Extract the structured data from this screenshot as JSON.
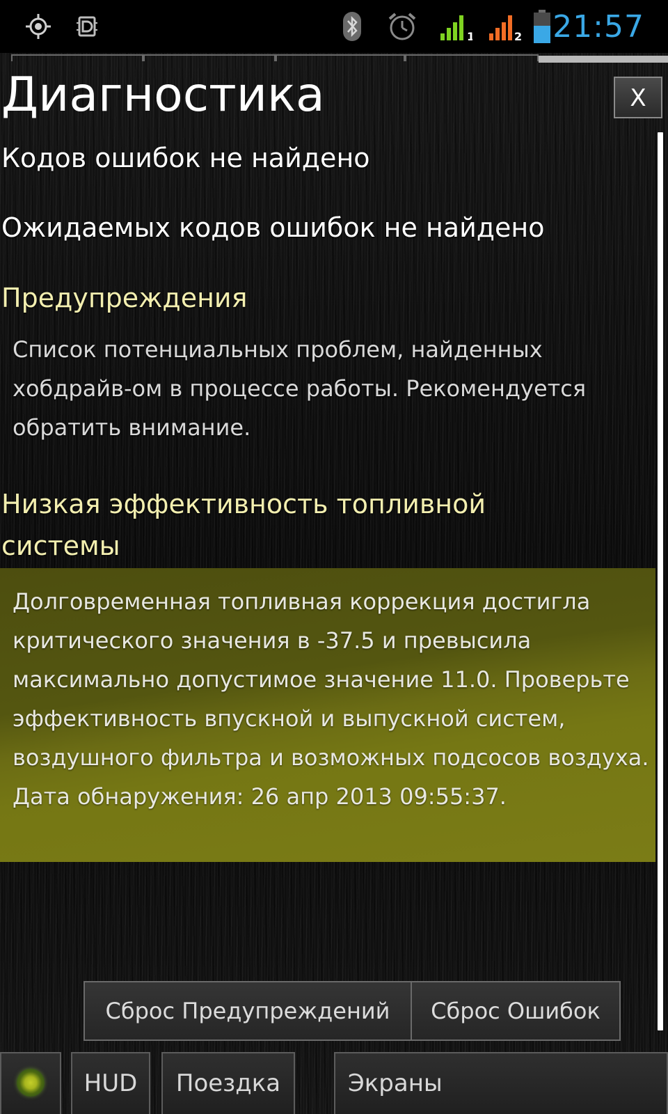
{
  "status_bar": {
    "time": "21:57",
    "icons": [
      "gps-icon",
      "debug-icon",
      "bluetooth-icon",
      "alarm-icon",
      "signal-sim1-icon",
      "signal-sim2-icon",
      "battery-icon"
    ],
    "signal1_label": "1",
    "signal2_label": "2",
    "colors": {
      "time": "#3aa8e6",
      "signal1": "#7fd321",
      "signal2": "#f26d25",
      "battery": "#3aa8e6"
    }
  },
  "page_indicator": {
    "segments": 5,
    "active_index": 4
  },
  "header": {
    "title": "Диагностика",
    "close_label": "X"
  },
  "content": {
    "no_error_codes": "Кодов ошибок не найдено",
    "no_pending_codes": "Ожидаемых кодов ошибок не найдено",
    "warnings_heading": "Предупреждения",
    "warnings_description": "Список потенциальных проблем, найденных хобдрайв-ом в процессе работы. Рекомендуется обратить внимание.",
    "issue_heading": "Низкая эффективность топливной системы",
    "issue_text": "Долговременная топливная коррекция достигла критического значения в -37.5 и превысила максимально допустимое значение 11.0. Проверьте эффективность впускной и выпускной систем, воздушного фильтра и возможных подсосов воздуха. Дата обнаружения: 26 апр 2013 09:55:37.",
    "colors": {
      "heading": "#f3efb0",
      "warning_card": "#6b6c14"
    }
  },
  "actions": {
    "reset_warnings": "Сброс Предупреждений",
    "reset_errors": "Сброс Ошибок"
  },
  "bottom_nav": {
    "hud": "HUD",
    "trip": "Поездка",
    "screens": "Экраны",
    "status_indicator_color": "#b4c223"
  }
}
